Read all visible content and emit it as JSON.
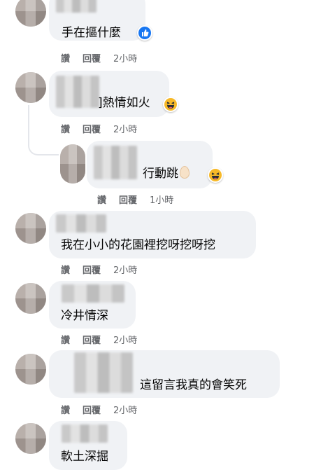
{
  "comments": [
    {
      "id": "c1",
      "text": "手在摳什麼",
      "reaction": "like-icon",
      "actions": {
        "like": "讚",
        "reply": "回覆",
        "time": "2小時"
      }
    },
    {
      "id": "c2",
      "text": "]熱情如火",
      "reaction": "laughing-emoji-icon",
      "actions": {
        "like": "讚",
        "reply": "回覆",
        "time": "2小時"
      }
    },
    {
      "id": "c3",
      "text": "行動跳",
      "reaction": "laughing-emoji-icon",
      "extra_icon": "egg-icon",
      "actions": {
        "like": "讚",
        "reply": "回覆",
        "time": "1小時"
      }
    },
    {
      "id": "c4",
      "text": "我在小小的花園裡挖呀挖呀挖",
      "actions": {
        "like": "讚",
        "reply": "回覆",
        "time": "2小時"
      }
    },
    {
      "id": "c5",
      "text": "冷井情深",
      "actions": {
        "like": "讚",
        "reply": "回覆",
        "time": "2小時"
      }
    },
    {
      "id": "c6",
      "text": "這留言我真的會笑死",
      "actions": {
        "like": "讚",
        "reply": "回覆",
        "time": "2小時"
      }
    },
    {
      "id": "c7",
      "text": "軟土深掘"
    }
  ],
  "colors": {
    "bubble": "#f0f2f5",
    "meta": "#65676b",
    "like_blue": "#1877f2",
    "emoji_yellow": "#f7b928"
  }
}
